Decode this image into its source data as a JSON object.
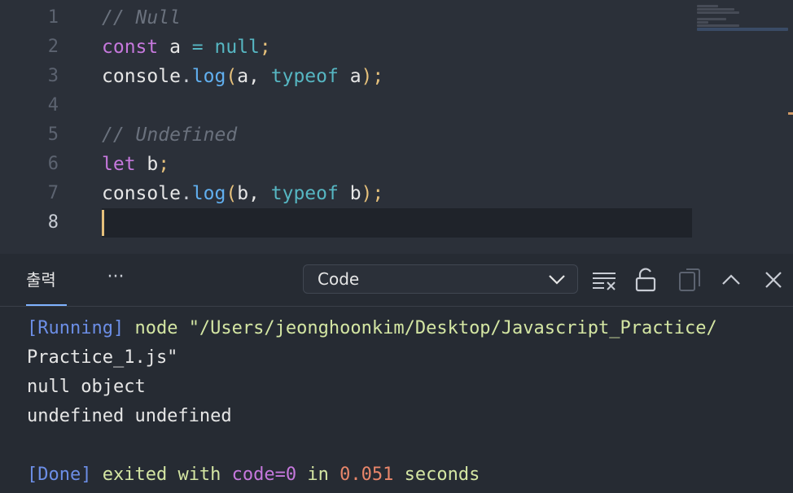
{
  "editor": {
    "line_numbers": [
      "1",
      "2",
      "3",
      "4",
      "5",
      "6",
      "7",
      "8"
    ],
    "lines": [
      [
        {
          "t": "// Null",
          "c": "t-comment"
        }
      ],
      [
        {
          "t": "const",
          "c": "t-kw"
        },
        {
          "t": " a ",
          "c": "t-var"
        },
        {
          "t": "=",
          "c": "t-op"
        },
        {
          "t": " ",
          "c": "t-var"
        },
        {
          "t": "null",
          "c": "t-null"
        },
        {
          "t": ";",
          "c": "t-semi"
        }
      ],
      [
        {
          "t": "console",
          "c": "t-var"
        },
        {
          "t": ".",
          "c": "t-punc"
        },
        {
          "t": "log",
          "c": "t-fn"
        },
        {
          "t": "(",
          "c": "t-paren"
        },
        {
          "t": "a, ",
          "c": "t-var"
        },
        {
          "t": "typeof",
          "c": "t-null"
        },
        {
          "t": " a",
          "c": "t-var"
        },
        {
          "t": ")",
          "c": "t-paren"
        },
        {
          "t": ";",
          "c": "t-semi"
        }
      ],
      [],
      [
        {
          "t": "// Undefined",
          "c": "t-comment"
        }
      ],
      [
        {
          "t": "let",
          "c": "t-kw"
        },
        {
          "t": " b",
          "c": "t-var"
        },
        {
          "t": ";",
          "c": "t-semi"
        }
      ],
      [
        {
          "t": "console",
          "c": "t-var"
        },
        {
          "t": ".",
          "c": "t-punc"
        },
        {
          "t": "log",
          "c": "t-fn"
        },
        {
          "t": "(",
          "c": "t-paren"
        },
        {
          "t": "b, ",
          "c": "t-var"
        },
        {
          "t": "typeof",
          "c": "t-null"
        },
        {
          "t": " b",
          "c": "t-var"
        },
        {
          "t": ")",
          "c": "t-paren"
        },
        {
          "t": ";",
          "c": "t-semi"
        }
      ],
      []
    ],
    "current_line": 8
  },
  "panel": {
    "tab_label": "출력",
    "more_label": "···",
    "channel_value": "Code",
    "icons": [
      "clear-output-icon",
      "unlock-icon",
      "copy-icon",
      "chevron-up-icon",
      "close-icon"
    ]
  },
  "output": {
    "line1": {
      "tag": "[Running]",
      "rest": " node \"/Users/jeonghoonkim/Desktop/Javascript_Practice/"
    },
    "line2": "Practice_1.js\"",
    "line3": "null object",
    "line4": "undefined undefined",
    "line5": "",
    "line6": {
      "tag": "[Done]",
      "a": " exited with ",
      "code": "code=0",
      "b": " in ",
      "time": "0.051",
      "c": " seconds"
    }
  },
  "colors": {
    "editor_bg": "#2b3039",
    "panel_bg": "#262b33",
    "accent": "#7fb3ff",
    "cursor": "#e5c07b"
  }
}
